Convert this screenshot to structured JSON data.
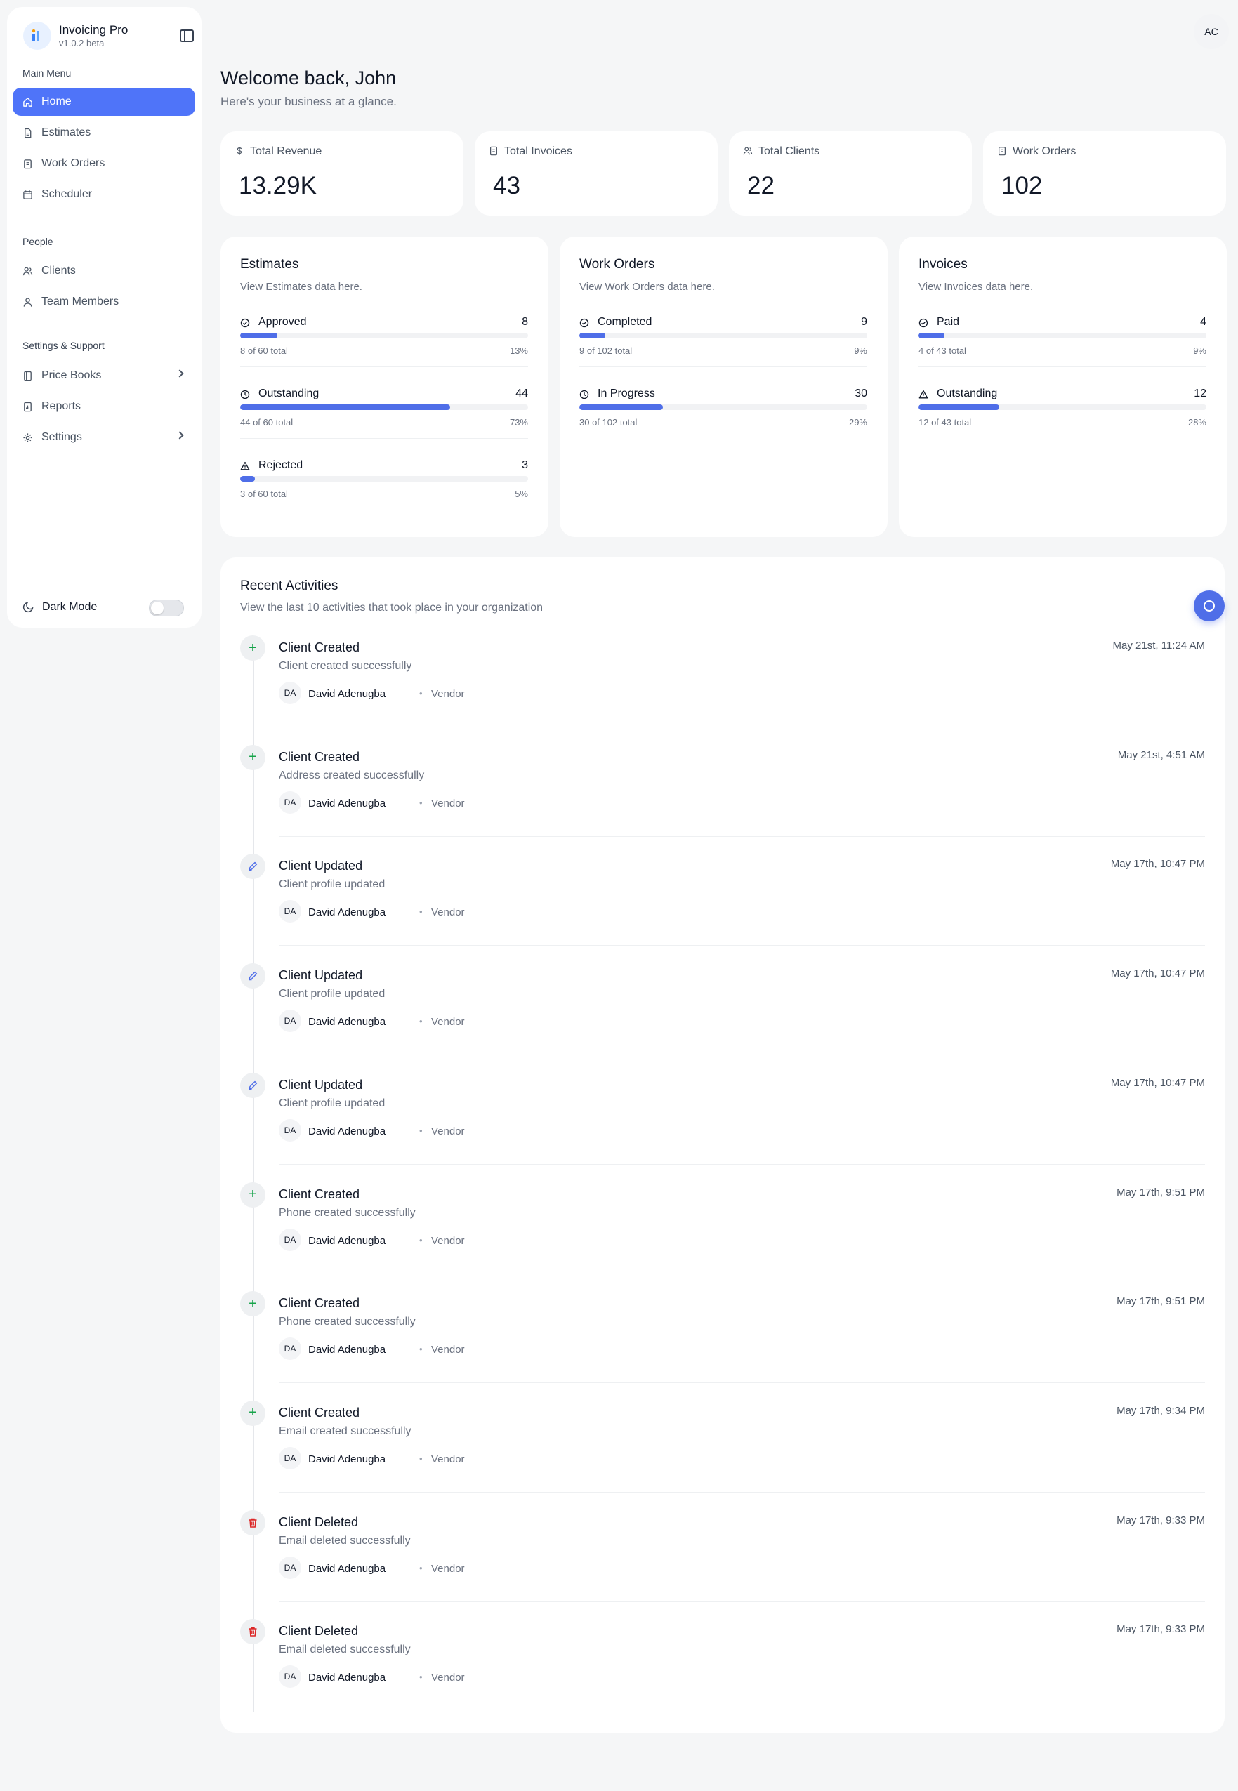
{
  "brand": {
    "name": "Invoicing Pro",
    "version": "v1.0.2 beta"
  },
  "sidebar": {
    "main_label": "Main Menu",
    "main_items": [
      {
        "label": "Home",
        "icon": "home-icon"
      },
      {
        "label": "Estimates",
        "icon": "file-text-icon"
      },
      {
        "label": "Work Orders",
        "icon": "clipboard-icon"
      },
      {
        "label": "Scheduler",
        "icon": "calendar-icon"
      }
    ],
    "people_label": "People",
    "people_items": [
      {
        "label": "Clients",
        "icon": "users-icon"
      },
      {
        "label": "Team Members",
        "icon": "team-icon"
      }
    ],
    "settings_label": "Settings & Support",
    "settings_items": [
      {
        "label": "Price Books",
        "icon": "book-icon"
      },
      {
        "label": "Reports",
        "icon": "report-icon"
      },
      {
        "label": "Settings",
        "icon": "gear-icon"
      }
    ],
    "dark_mode_label": "Dark Mode",
    "dark_mode_on": false
  },
  "header": {
    "avatar_initials": "AC",
    "welcome": "Welcome back, John",
    "subtitle": "Here's your business at a glance."
  },
  "stats": [
    {
      "label": "Total Revenue",
      "value": "13.29K",
      "icon": "dollar-icon"
    },
    {
      "label": "Total Invoices",
      "value": "43",
      "icon": "invoice-icon"
    },
    {
      "label": "Total Clients",
      "value": "22",
      "icon": "users-icon"
    },
    {
      "label": "Work Orders",
      "value": "102",
      "icon": "clipboard-icon"
    }
  ],
  "breakdowns": [
    {
      "title": "Estimates",
      "desc": "View Estimates data here.",
      "metrics": [
        {
          "label": "Approved",
          "value": "8",
          "total": "8 of 60 total",
          "pct": "13%",
          "fraction": 0.13,
          "icon": "check-circle-icon"
        },
        {
          "label": "Outstanding",
          "value": "44",
          "total": "44 of 60 total",
          "pct": "73%",
          "fraction": 0.73,
          "icon": "clock-icon"
        },
        {
          "label": "Rejected",
          "value": "3",
          "total": "3 of 60 total",
          "pct": "5%",
          "fraction": 0.05,
          "icon": "warning-icon"
        }
      ]
    },
    {
      "title": "Work Orders",
      "desc": "View Work Orders data here.",
      "metrics": [
        {
          "label": "Completed",
          "value": "9",
          "total": "9 of 102 total",
          "pct": "9%",
          "fraction": 0.09,
          "icon": "check-circle-icon"
        },
        {
          "label": "In Progress",
          "value": "30",
          "total": "30 of 102 total",
          "pct": "29%",
          "fraction": 0.29,
          "icon": "clock-icon"
        }
      ]
    },
    {
      "title": "Invoices",
      "desc": "View Invoices data here.",
      "metrics": [
        {
          "label": "Paid",
          "value": "4",
          "total": "4 of 43 total",
          "pct": "9%",
          "fraction": 0.09,
          "icon": "check-circle-icon"
        },
        {
          "label": "Outstanding",
          "value": "12",
          "total": "12 of 43 total",
          "pct": "28%",
          "fraction": 0.28,
          "icon": "warning-icon"
        }
      ]
    }
  ],
  "activities": {
    "title": "Recent Activities",
    "desc": "View the last 10 activities that took place in your organization",
    "items": [
      {
        "type": "plus",
        "title": "Client Created",
        "desc": "Client created successfully",
        "initials": "DA",
        "user": "David Adenugba",
        "role": "Vendor",
        "time": "May 21st, 11:24 AM"
      },
      {
        "type": "plus",
        "title": "Client Created",
        "desc": "Address created successfully",
        "initials": "DA",
        "user": "David Adenugba",
        "role": "Vendor",
        "time": "May 21st, 4:51 AM"
      },
      {
        "type": "edit",
        "title": "Client Updated",
        "desc": "Client profile updated",
        "initials": "DA",
        "user": "David Adenugba",
        "role": "Vendor",
        "time": "May 17th, 10:47 PM"
      },
      {
        "type": "edit",
        "title": "Client Updated",
        "desc": "Client profile updated",
        "initials": "DA",
        "user": "David Adenugba",
        "role": "Vendor",
        "time": "May 17th, 10:47 PM"
      },
      {
        "type": "edit",
        "title": "Client Updated",
        "desc": "Client profile updated",
        "initials": "DA",
        "user": "David Adenugba",
        "role": "Vendor",
        "time": "May 17th, 10:47 PM"
      },
      {
        "type": "plus",
        "title": "Client Created",
        "desc": "Phone created successfully",
        "initials": "DA",
        "user": "David Adenugba",
        "role": "Vendor",
        "time": "May 17th, 9:51 PM"
      },
      {
        "type": "plus",
        "title": "Client Created",
        "desc": "Phone created successfully",
        "initials": "DA",
        "user": "David Adenugba",
        "role": "Vendor",
        "time": "May 17th, 9:51 PM"
      },
      {
        "type": "plus",
        "title": "Client Created",
        "desc": "Email created successfully",
        "initials": "DA",
        "user": "David Adenugba",
        "role": "Vendor",
        "time": "May 17th, 9:34 PM"
      },
      {
        "type": "del",
        "title": "Client Deleted",
        "desc": "Email deleted successfully",
        "initials": "DA",
        "user": "David Adenugba",
        "role": "Vendor",
        "time": "May 17th, 9:33 PM"
      },
      {
        "type": "del",
        "title": "Client Deleted",
        "desc": "Email deleted successfully",
        "initials": "DA",
        "user": "David Adenugba",
        "role": "Vendor",
        "time": "May 17th, 9:33 PM"
      }
    ]
  },
  "colors": {
    "accent": "#4f74f9",
    "bar": "#4f6ee8",
    "success": "#16a34a",
    "danger": "#dc2626"
  }
}
